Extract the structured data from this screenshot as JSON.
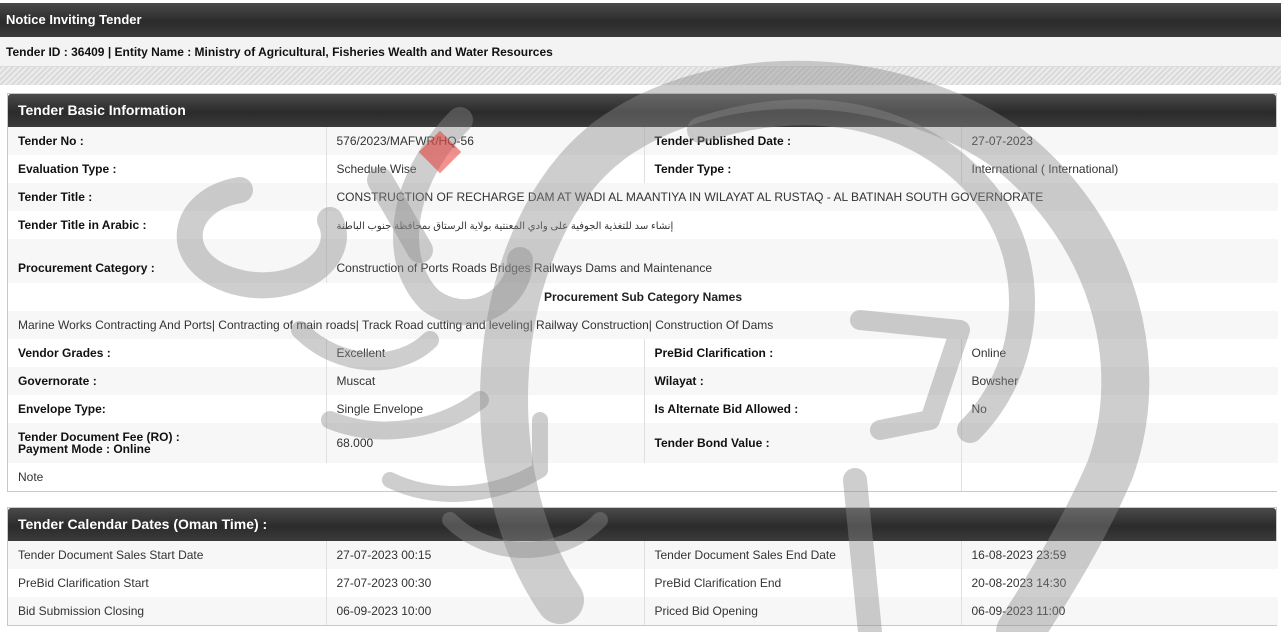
{
  "page": {
    "title": "Notice Inviting Tender",
    "id_line": "Tender ID : 36409 | Entity Name : Ministry of Agricultural, Fisheries Wealth and Water Resources"
  },
  "basic": {
    "heading": "Tender Basic Information",
    "tender_no_label": "Tender No :",
    "tender_no": "576/2023/MAFWR/HQ-56",
    "published_label": "Tender Published Date :",
    "published": "27-07-2023",
    "eval_label": "Evaluation Type :",
    "eval": "Schedule Wise",
    "type_label": "Tender Type :",
    "type": "International  ( International)",
    "title_label": "Tender Title :",
    "title": "CONSTRUCTION OF RECHARGE DAM AT WADI AL MAANTIYA IN WILAYAT AL RUSTAQ - AL BATINAH SOUTH GOVERNORATE",
    "title_ar_label": "Tender Title in Arabic :",
    "title_ar": "إنشاء سد للتغذية الجوفية على وادي المعنتية بولاية الرستاق بمحافظة جنوب الباطنة",
    "proc_cat_label": "Procurement Category :",
    "proc_cat": "Construction of Ports Roads Bridges Railways Dams and Maintenance",
    "sub_cat_heading": "Procurement Sub Category Names",
    "sub_cats": "Marine Works Contracting And Ports| Contracting of main roads| Track Road cutting and leveling| Railway Construction| Construction Of Dams",
    "vendor_label": "Vendor Grades :",
    "vendor": "Excellent",
    "prebid_label": "PreBid Clarification :",
    "prebid": "Online",
    "gov_label": "Governorate :",
    "gov": "Muscat",
    "wilayat_label": "Wilayat :",
    "wilayat": "Bowsher",
    "envelope_label": "Envelope Type:",
    "envelope": "Single Envelope",
    "alt_label": "Is Alternate Bid Allowed :",
    "alt": "No",
    "fee_label": "Tender Document Fee (RO) :",
    "payment_label": "Payment Mode :  Online",
    "fee": "68.000",
    "bond_label": "Tender Bond Value :",
    "bond": "",
    "note_label": "Note"
  },
  "calendar": {
    "heading": "Tender Calendar Dates (Oman Time) :",
    "rows": [
      {
        "l1": "Tender Document Sales Start Date",
        "v1": "27-07-2023 00:15",
        "l2": "Tender Document Sales End Date",
        "v2": "16-08-2023 23:59"
      },
      {
        "l1": "PreBid Clarification Start",
        "v1": "27-07-2023 00:30",
        "l2": "PreBid Clarification End",
        "v2": "20-08-2023 14:30"
      },
      {
        "l1": "Bid Submission Closing",
        "v1": "06-09-2023 10:00",
        "l2": "Priced Bid Opening",
        "v2": "06-09-2023 11:00"
      }
    ]
  }
}
